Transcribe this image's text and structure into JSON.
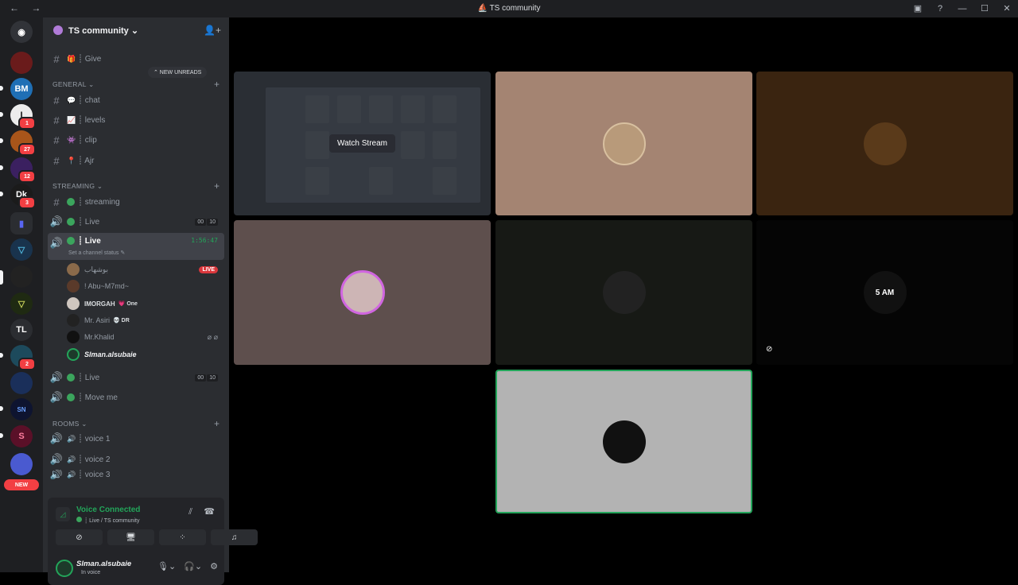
{
  "window": {
    "title": "TS community",
    "nav": "← →",
    "controls": [
      "▣",
      "?",
      "—",
      "☐",
      "✕"
    ],
    "title_icon": "discord-icon"
  },
  "guilds": {
    "items": [
      {
        "label": "◉",
        "color": "#5865f2"
      },
      {
        "label": "",
        "color": "#6a1b1b"
      },
      {
        "label": "BM",
        "color": "#1f6fb5"
      },
      {
        "label": "I",
        "color": "#ececec",
        "badge": "1"
      },
      {
        "label": "",
        "color": "#a8551a",
        "badge": "27"
      },
      {
        "label": "",
        "color": "#3b2060",
        "badge": "12"
      },
      {
        "label": "Dk",
        "color": "#1b1b1b",
        "badge": "3"
      },
      {
        "label": "▮",
        "color": "#5865f2"
      },
      {
        "label": "▽",
        "color": "#19334d"
      },
      {
        "label": "",
        "color": "#222",
        "badge": ""
      },
      {
        "label": "▽",
        "color": "#1f2a12"
      },
      {
        "label": "TL",
        "color": "#2b2d31"
      },
      {
        "label": "",
        "color": "#1d4a5c",
        "badge": "2"
      },
      {
        "label": "",
        "color": "#1a2f5a"
      },
      {
        "label": "SN",
        "color": "#0e1430"
      },
      {
        "label": "S",
        "color": "#5a1028"
      },
      {
        "label": "",
        "color": "#4a5ad0"
      }
    ],
    "new_label": "NEW"
  },
  "server": {
    "name": "TS community",
    "chevron": "⌄",
    "invite_icon": "add-member-icon"
  },
  "channels": {
    "new_unreads": "⌃ NEW UNREADS",
    "give": "┊ Give",
    "general": {
      "label": "GENERAL ⌄",
      "items": [
        "┊ chat",
        "┊ levels",
        "┊ clip",
        "┊ Ajr"
      ]
    },
    "streaming": {
      "label": "STREAMING ⌄",
      "streaming_text": "┊ streaming",
      "live1": {
        "name": "┊ Live",
        "counts": [
          "00",
          "10"
        ]
      },
      "live_active": {
        "name": "┊ Live",
        "timer": "1:56:47",
        "status": "Set a channel status ✎"
      },
      "users": [
        {
          "name": "بوشهاب",
          "live": "LIVE"
        },
        {
          "name": "! Abu~M7md~"
        },
        {
          "name": "IMORGAH",
          "tag": "💗 One"
        },
        {
          "name": "Mr. Asiri",
          "tag": "💀 DR"
        },
        {
          "name": "Mr.Khalid",
          "icons": "⌀ ⌀"
        },
        {
          "name": "Slman.alsubaie"
        }
      ],
      "live2": {
        "name": "┊ Live",
        "counts": [
          "00",
          "10"
        ]
      },
      "move": "┊ Move me"
    },
    "rooms": {
      "label": "ROOMS ⌄",
      "items": [
        "┊ voice 1",
        "┊ voice 2",
        "┊ voice 3"
      ]
    }
  },
  "voice_panel": {
    "title": "Voice Connected",
    "subtitle": "┊ Live / TS community",
    "me": {
      "name": "Slman.alsubaie",
      "status": "In voice"
    }
  },
  "stage": {
    "watch_stream": "Watch Stream",
    "clock_text": "5 AM"
  }
}
